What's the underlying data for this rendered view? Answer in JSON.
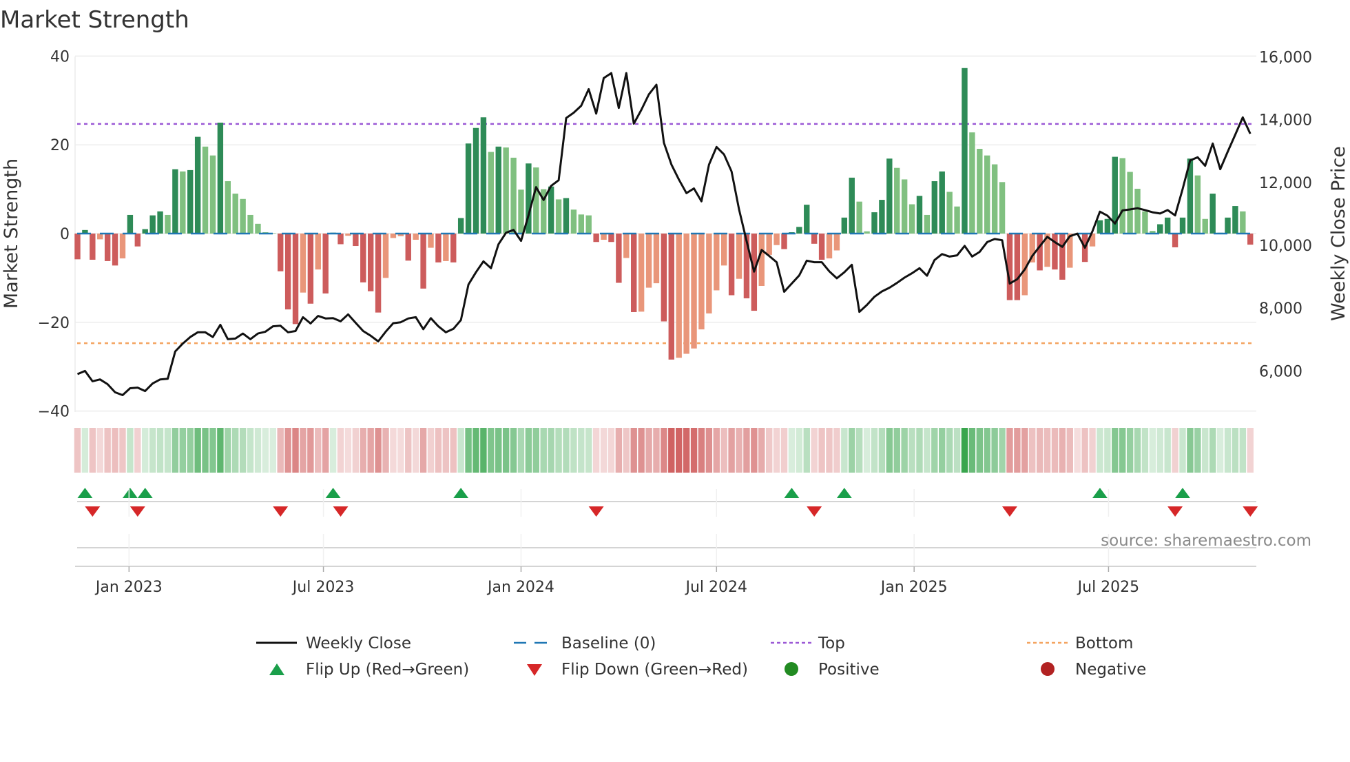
{
  "chart_data": {
    "type": "bar",
    "title": "Market Strength",
    "ylabel": "Market Strength",
    "y2label": "Weekly Close Price",
    "ylim": [
      -40,
      40
    ],
    "y2lim": [
      4400,
      16000
    ],
    "yticks": [
      "40",
      "20",
      "0",
      "−20",
      "−40"
    ],
    "yticks_values": [
      40,
      20,
      0,
      -20,
      -40
    ],
    "y2ticks": [
      "16,000",
      "14,000",
      "12,000",
      "10,000",
      "8,000",
      "6,000"
    ],
    "y2ticks_values": [
      16000,
      14000,
      12000,
      10000,
      8000,
      6000
    ],
    "x_start_date": "2022-11-14",
    "x_frequency": "weekly",
    "xticks": [
      {
        "label": "Jan 2023",
        "date": "2023-01-01"
      },
      {
        "label": "Jul 2023",
        "date": "2023-07-01"
      },
      {
        "label": "Jan 2024",
        "date": "2024-01-01"
      },
      {
        "label": "Jul 2024",
        "date": "2024-07-01"
      },
      {
        "label": "Jan 2025",
        "date": "2025-01-01"
      },
      {
        "label": "Jul 2025",
        "date": "2025-07-01"
      }
    ],
    "top_level": 24.7,
    "bottom_level": -24.7,
    "baseline": 0,
    "strength": [
      -5.8,
      0.8,
      -5.9,
      -1.3,
      -6.2,
      -7.2,
      -5.6,
      4.2,
      -2.9,
      1.0,
      4.1,
      5.0,
      4.2,
      14.5,
      14.0,
      14.3,
      21.8,
      19.6,
      17.6,
      25.0,
      11.8,
      9.0,
      7.8,
      4.2,
      2.2,
      0.3,
      0.1,
      -8.5,
      -17.1,
      -20.4,
      -13.3,
      -15.8,
      -8.1,
      -13.5,
      0.2,
      -2.4,
      -0.5,
      -2.8,
      -11.0,
      -13.0,
      -17.8,
      -10.0,
      -1.0,
      -0.6,
      -6.1,
      -1.4,
      -12.4,
      -3.2,
      -6.5,
      -6.2,
      -6.5,
      3.5,
      20.3,
      23.8,
      26.2,
      18.4,
      19.6,
      19.4,
      17.1,
      9.9,
      15.8,
      14.9,
      10.0,
      10.6,
      7.7,
      8.0,
      5.4,
      4.3,
      4.1,
      -1.9,
      -1.4,
      -1.9,
      -11.1,
      -5.5,
      -17.7,
      -17.6,
      -12.2,
      -11.2,
      -19.8,
      -28.4,
      -28.0,
      -27.1,
      -25.9,
      -21.6,
      -18.0,
      -12.8,
      -7.2,
      -13.9,
      -10.2,
      -14.6,
      -17.4,
      -11.8,
      -4.8,
      -2.6,
      -3.5,
      0.3,
      1.5,
      6.5,
      -2.3,
      -5.9,
      -5.6,
      -3.8,
      3.6,
      12.6,
      7.2,
      0.5,
      4.8,
      7.6,
      16.9,
      14.8,
      12.2,
      6.6,
      8.5,
      4.2,
      11.8,
      14.0,
      9.4,
      6.1,
      37.3,
      22.8,
      19.1,
      17.6,
      15.6,
      11.6,
      -15.0,
      -15.0,
      -13.9,
      -6.5,
      -8.3,
      -7.5,
      -8.1,
      -10.4,
      -7.7,
      -0.2,
      -6.4,
      -2.9,
      3.0,
      3.3,
      17.3,
      17.0,
      13.9,
      10.1,
      5.0,
      0.6,
      2.1,
      3.6,
      -3.1,
      3.6,
      16.9,
      13.1,
      3.3,
      9.0,
      0.2,
      3.6,
      6.2,
      5.0,
      -2.5
    ],
    "weekly_close": [
      5900,
      6000,
      5670,
      5730,
      5580,
      5320,
      5230,
      5450,
      5470,
      5360,
      5600,
      5730,
      5750,
      6620,
      6870,
      7080,
      7230,
      7230,
      7080,
      7470,
      7010,
      7030,
      7190,
      7010,
      7190,
      7250,
      7420,
      7440,
      7230,
      7270,
      7710,
      7510,
      7750,
      7670,
      7680,
      7580,
      7800,
      7530,
      7270,
      7120,
      6940,
      7250,
      7520,
      7550,
      7670,
      7710,
      7330,
      7680,
      7420,
      7230,
      7340,
      7620,
      8750,
      9140,
      9490,
      9270,
      10030,
      10400,
      10490,
      10140,
      10960,
      11850,
      11440,
      11890,
      12070,
      14050,
      14220,
      14440,
      14970,
      14190,
      15320,
      15480,
      14370,
      15480,
      13870,
      14310,
      14800,
      15110,
      13260,
      12570,
      12090,
      11660,
      11810,
      11400,
      12570,
      13130,
      12890,
      12350,
      11140,
      10140,
      9160,
      9850,
      9660,
      9460,
      8520,
      8780,
      9040,
      9510,
      9460,
      9460,
      9170,
      8950,
      9140,
      9380,
      7880,
      8100,
      8360,
      8530,
      8650,
      8800,
      8970,
      9110,
      9270,
      9030,
      9530,
      9720,
      9640,
      9680,
      9980,
      9640,
      9790,
      10100,
      10200,
      10160,
      8780,
      8920,
      9230,
      9660,
      9970,
      10270,
      10100,
      9950,
      10290,
      10370,
      9920,
      10440,
      11070,
      10940,
      10690,
      11110,
      11140,
      11180,
      11120,
      11050,
      11010,
      11120,
      10950,
      11790,
      12700,
      12800,
      12530,
      13240,
      12420,
      12980,
      13520,
      14070,
      13550
    ],
    "flip_up_weeks": [
      2,
      8,
      10,
      35,
      52,
      96,
      103,
      137,
      148
    ],
    "flip_down_weeks": [
      3,
      9,
      28,
      36,
      70,
      99,
      125,
      147,
      157
    ],
    "legend": {
      "placement": "bottom",
      "items": [
        {
          "label": "Weekly Close",
          "kind": "line"
        },
        {
          "label": "Baseline (0)",
          "kind": "dash"
        },
        {
          "label": "Top",
          "kind": "dot-purple"
        },
        {
          "label": "Bottom",
          "kind": "dot-orange"
        },
        {
          "label": "Flip Up (Red→Green)",
          "kind": "tri-up"
        },
        {
          "label": "Flip Down (Green→Red)",
          "kind": "tri-down"
        },
        {
          "label": "Positive",
          "kind": "circle-green"
        },
        {
          "label": "Negative",
          "kind": "circle-red"
        }
      ]
    },
    "colors": {
      "pos_strong": "#2e8b57",
      "pos_weak": "#80c080",
      "neg_strong": "#cd5c5c",
      "neg_weak": "#e9967a",
      "line": "#111111",
      "baseline": "#1f77b4",
      "top": "#9b59d6",
      "bottom": "#f4a460",
      "flip_up": "#1a9f4a",
      "flip_down": "#d62728",
      "positive": "#228b22",
      "negative": "#b22222"
    }
  },
  "source": "source: sharemaestro.com"
}
